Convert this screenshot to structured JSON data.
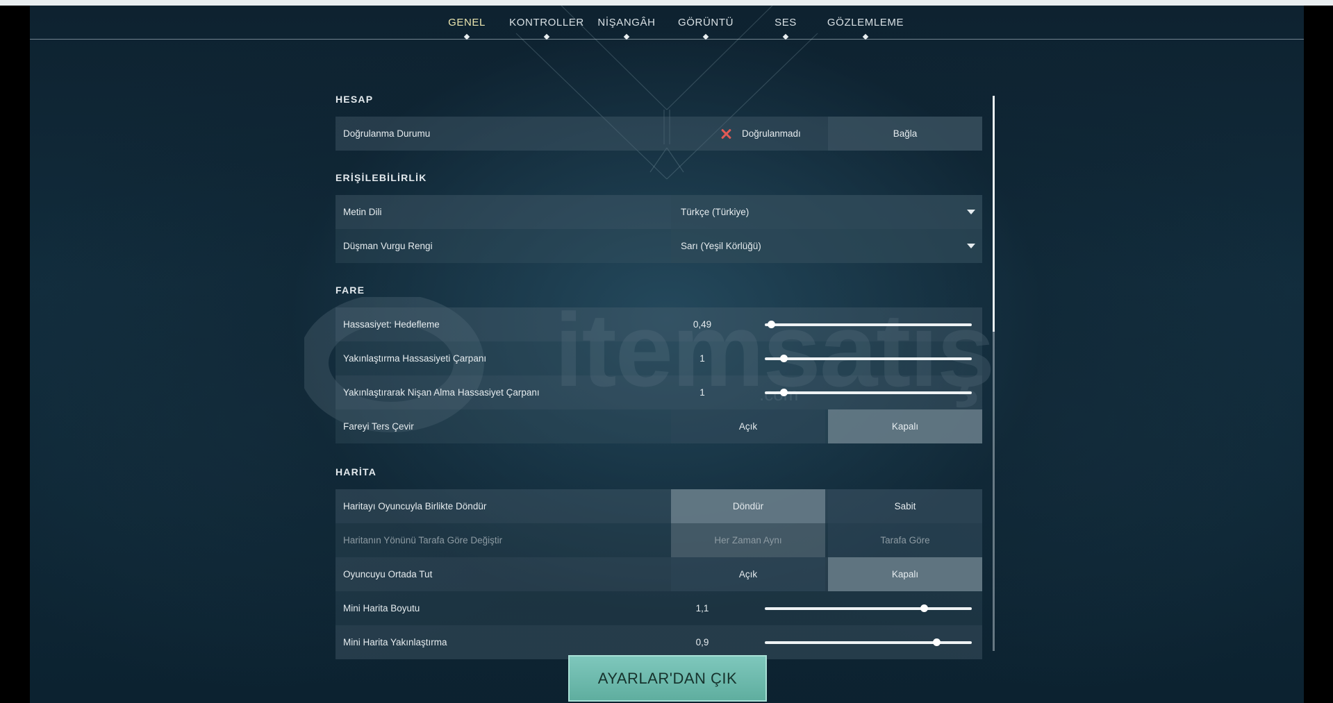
{
  "tabs": [
    {
      "label": "GENEL",
      "active": true
    },
    {
      "label": "KONTROLLER",
      "active": false
    },
    {
      "label": "NİŞANGÂH",
      "active": false
    },
    {
      "label": "GÖRÜNTÜ",
      "active": false
    },
    {
      "label": "SES",
      "active": false
    },
    {
      "label": "GÖZLEMLEME",
      "active": false
    }
  ],
  "sections": {
    "hesap": "HESAP",
    "erisilebilirlik": "ERİŞİLEBİLİRLİK",
    "fare": "FARE",
    "harita": "HARİTA"
  },
  "hesap": {
    "dogrulama": {
      "label": "Doğrulanma Durumu",
      "status": "Doğrulanmadı",
      "status_icon": "x-icon",
      "button": "Bağla"
    }
  },
  "erisilebilirlik": {
    "metin_dili": {
      "label": "Metin Dili",
      "value": "Türkçe (Türkiye)"
    },
    "dusman_rengi": {
      "label": "Düşman Vurgu Rengi",
      "value": "Sarı (Yeşil Körlüğü)"
    }
  },
  "fare": {
    "hassasiyet": {
      "label": "Hassasiyet: Hedefleme",
      "value": "0,49",
      "fraction": 0.03
    },
    "yakinlastirma": {
      "label": "Yakınlaştırma Hassasiyeti Çarpanı",
      "value": "1",
      "fraction": 0.09
    },
    "nisan_alma": {
      "label": "Yakınlaştırarak Nişan Alma Hassasiyet Çarpanı",
      "value": "1",
      "fraction": 0.09
    },
    "ters_cevir": {
      "label": "Fareyi Ters Çevir",
      "on_label": "Açık",
      "off_label": "Kapalı",
      "selected": "off"
    }
  },
  "harita": {
    "dondur": {
      "label": "Haritayı Oyuncuyla Birlikte Döndür",
      "left": "Döndür",
      "right": "Sabit",
      "selected": "left"
    },
    "yon": {
      "label": "Haritanın Yönünü Tarafa Göre Değiştir",
      "left": "Her Zaman Aynı",
      "right": "Tarafa Göre",
      "selected": "left",
      "disabled": true
    },
    "ortada": {
      "label": "Oyuncuyu Ortada Tut",
      "on_label": "Açık",
      "off_label": "Kapalı",
      "selected": "off"
    },
    "boyut": {
      "label": "Mini Harita Boyutu",
      "value": "1,1",
      "fraction": 0.77
    },
    "yakinlastirma": {
      "label": "Mini Harita Yakınlaştırma",
      "value": "0,9",
      "fraction": 0.83
    }
  },
  "exit_button": "AYARLAR'DAN ÇIK",
  "watermark": {
    "brand": "itemsatış",
    "sub": ".com"
  },
  "colors": {
    "accent_tab": "#ece6b0",
    "exit_button": "#6dbbad",
    "error_icon": "#e05a55"
  }
}
